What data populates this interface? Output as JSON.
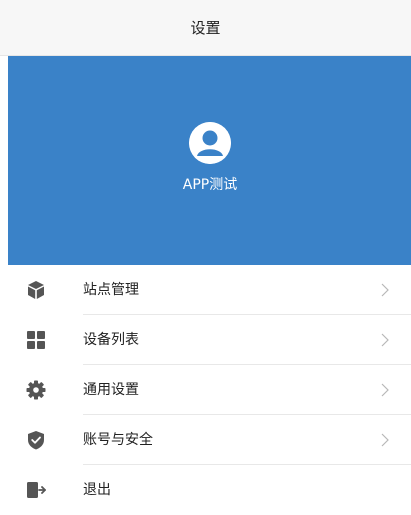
{
  "header": {
    "title": "设置"
  },
  "profile": {
    "username": "APP测试"
  },
  "menu": {
    "items": [
      {
        "label": "站点管理",
        "icon": "cube-icon"
      },
      {
        "label": "设备列表",
        "icon": "grid-icon"
      },
      {
        "label": "通用设置",
        "icon": "gear-icon"
      },
      {
        "label": "账号与安全",
        "icon": "shield-icon"
      },
      {
        "label": "退出",
        "icon": "logout-icon"
      }
    ]
  },
  "colors": {
    "banner": "#3a82c8",
    "icon": "#555555",
    "header_bg": "#f7f7f7",
    "chevron": "#b8b8b8"
  }
}
